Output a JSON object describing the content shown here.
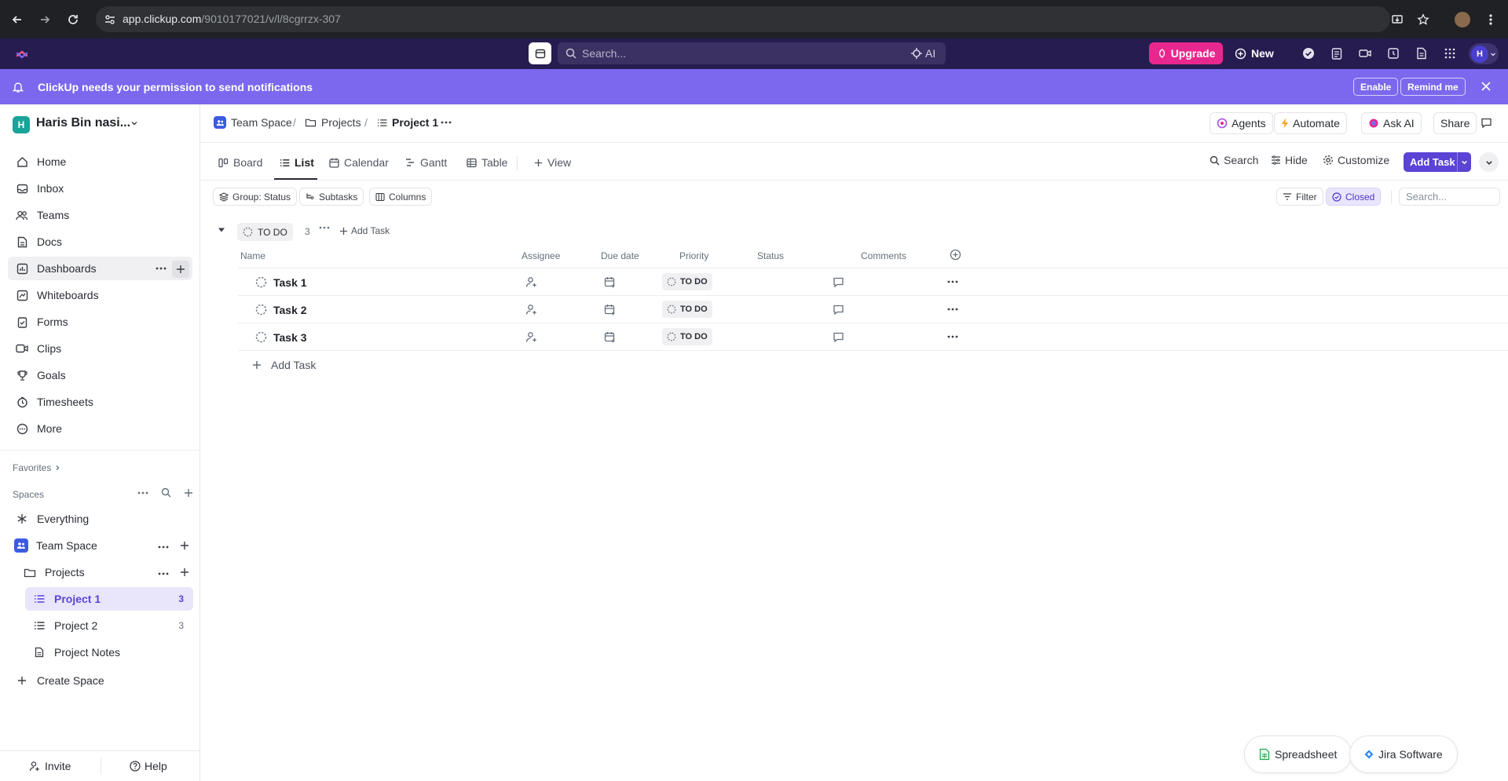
{
  "browser": {
    "url_host": "app.clickup.com",
    "url_path": "/9010177021/v/l/8cgrrzx-307"
  },
  "topbar": {
    "search_placeholder": "Search...",
    "ai_label": "AI",
    "upgrade_label": "Upgrade",
    "new_label": "New",
    "avatar_initial": "H"
  },
  "banner": {
    "text": "ClickUp needs your permission to send notifications",
    "enable_label": "Enable",
    "remind_label": "Remind me"
  },
  "sidebar": {
    "workspace_initial": "H",
    "workspace_name": "Haris Bin nasi...",
    "nav": [
      {
        "label": "Home",
        "icon": "home-icon"
      },
      {
        "label": "Inbox",
        "icon": "inbox-icon"
      },
      {
        "label": "Teams",
        "icon": "teams-icon"
      },
      {
        "label": "Docs",
        "icon": "docs-icon"
      },
      {
        "label": "Dashboards",
        "icon": "dashboards-icon"
      },
      {
        "label": "Whiteboards",
        "icon": "whiteboards-icon"
      },
      {
        "label": "Forms",
        "icon": "forms-icon"
      },
      {
        "label": "Clips",
        "icon": "clips-icon"
      },
      {
        "label": "Goals",
        "icon": "goals-icon"
      },
      {
        "label": "Timesheets",
        "icon": "timesheets-icon"
      },
      {
        "label": "More",
        "icon": "more-icon"
      }
    ],
    "favorites_label": "Favorites",
    "spaces_label": "Spaces",
    "everything_label": "Everything",
    "team_space_label": "Team Space",
    "projects_folder_label": "Projects",
    "project1_label": "Project 1",
    "project1_count": "3",
    "project2_label": "Project 2",
    "project2_count": "3",
    "notes_label": "Project Notes",
    "create_space_label": "Create Space",
    "invite_label": "Invite",
    "help_label": "Help"
  },
  "header": {
    "crumb_space": "Team Space",
    "crumb_folder": "Projects",
    "crumb_list": "Project 1",
    "sep": "/",
    "agents_label": "Agents",
    "automate_label": "Automate",
    "ask_ai_label": "Ask AI",
    "share_label": "Share"
  },
  "views": {
    "board": "Board",
    "list": "List",
    "calendar": "Calendar",
    "gantt": "Gantt",
    "table": "Table",
    "add_view": "View",
    "search": "Search",
    "hide": "Hide",
    "customize": "Customize",
    "add_task": "Add Task"
  },
  "filters": {
    "group": "Group: Status",
    "subtasks": "Subtasks",
    "columns": "Columns",
    "filter": "Filter",
    "closed": "Closed",
    "search_placeholder": "Search..."
  },
  "group": {
    "status": "TO DO",
    "count": "3",
    "add_task": "Add Task"
  },
  "columns": {
    "name": "Name",
    "assignee": "Assignee",
    "due_date": "Due date",
    "priority": "Priority",
    "status": "Status",
    "comments": "Comments"
  },
  "tasks": [
    {
      "name": "Task 1",
      "status": "TO DO"
    },
    {
      "name": "Task 2",
      "status": "TO DO"
    },
    {
      "name": "Task 3",
      "status": "TO DO"
    }
  ],
  "add_task_row": "Add Task",
  "integrations": {
    "spreadsheet": "Spreadsheet",
    "jira": "Jira Software"
  },
  "colors": {
    "brand_purple": "#7b68ee",
    "accent": "#5b43d6",
    "upgrade_pink": "#e8288e",
    "topbar": "#261c4f"
  }
}
